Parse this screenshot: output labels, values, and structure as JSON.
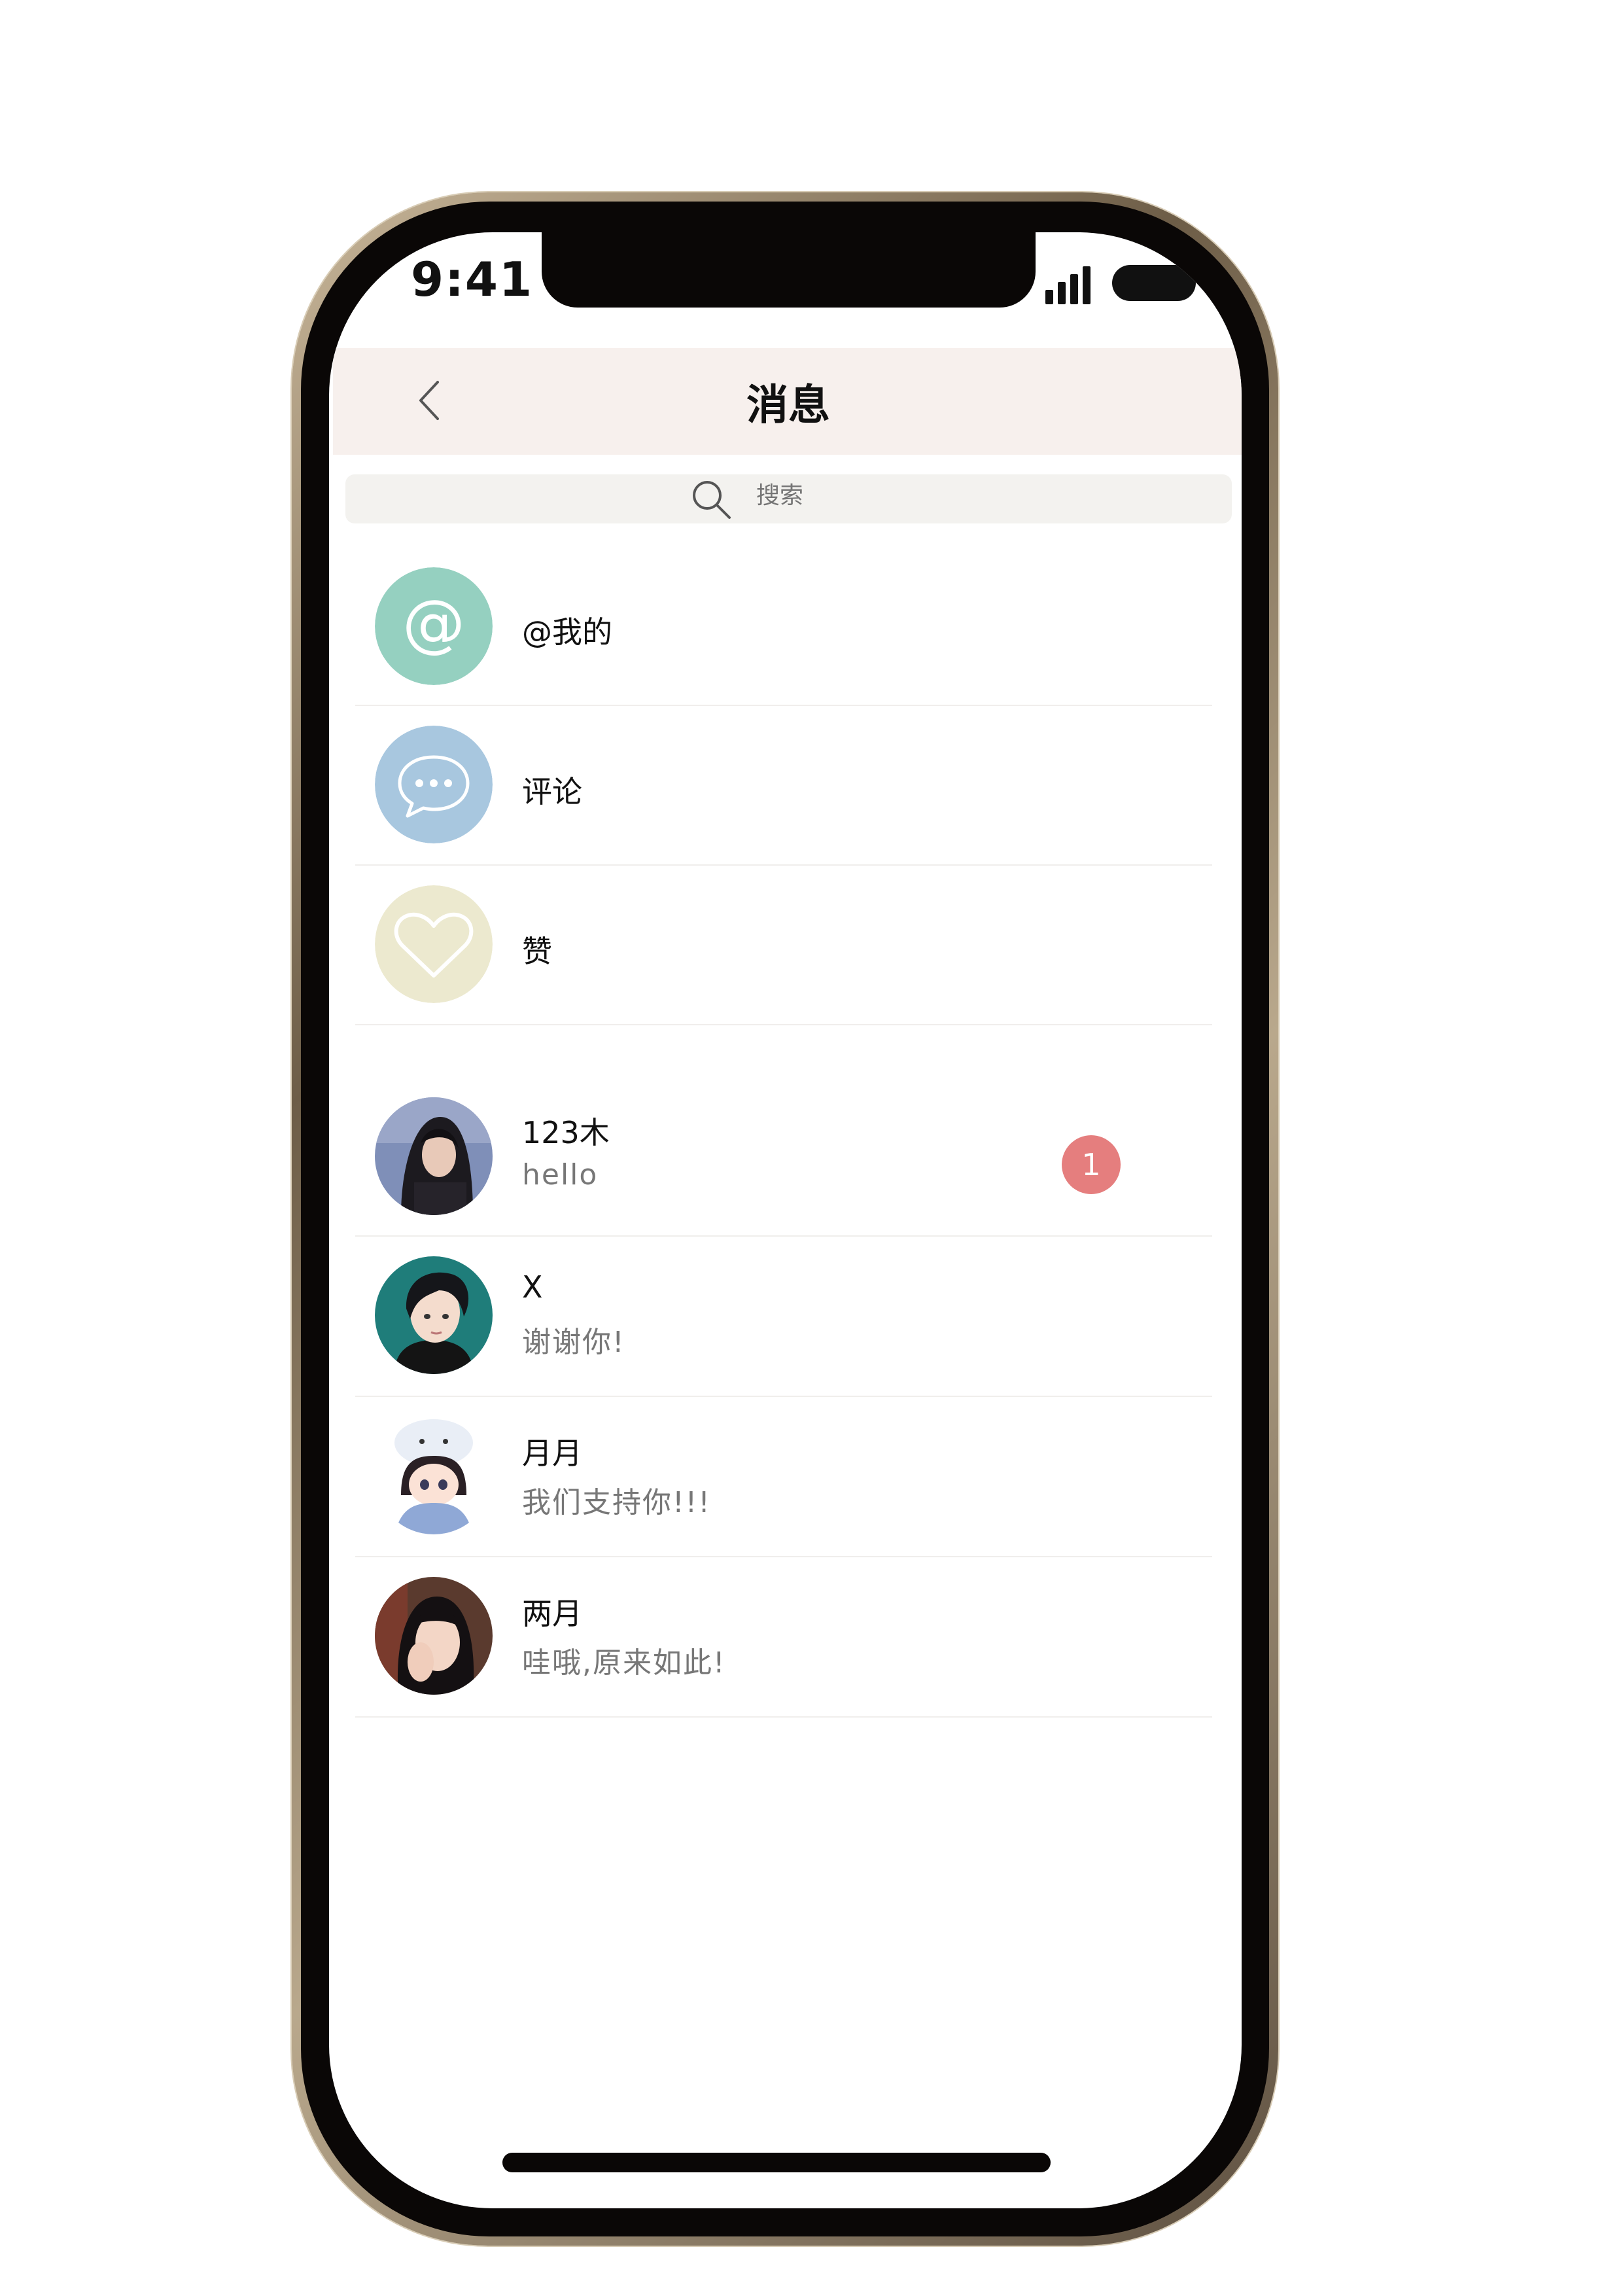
{
  "status_bar": {
    "time": "9:41"
  },
  "header": {
    "title": "消息"
  },
  "search": {
    "placeholder": "搜索"
  },
  "categories": [
    {
      "label": "@我的",
      "icon": "at-icon",
      "color": "#95d0c0"
    },
    {
      "label": "评论",
      "icon": "comment-bubble-icon",
      "color": "#a8c7df"
    },
    {
      "label": "赞",
      "icon": "heart-icon",
      "color": "#ece9cf"
    }
  ],
  "conversations": [
    {
      "name": "123木",
      "message": "hello",
      "unread": "1"
    },
    {
      "name": "X",
      "message": "谢谢你!"
    },
    {
      "name": "月月",
      "message": "我们支持你!!!"
    },
    {
      "name": "两月",
      "message": "哇哦,原来如此!"
    }
  ],
  "colors": {
    "header_bg": "#f7f0ed",
    "badge": "#e57e7e",
    "search_bg": "#f3f2ef"
  }
}
